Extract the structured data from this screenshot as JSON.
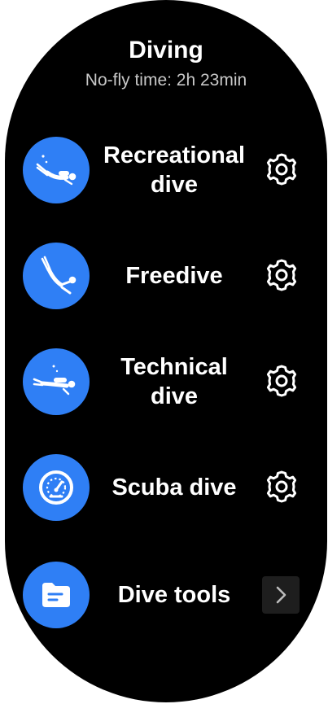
{
  "header": {
    "title": "Diving",
    "subtitle": "No-fly time: 2h 23min"
  },
  "items": [
    {
      "label_line1": "Recreational",
      "label_line2": "dive",
      "icon": "recreational-diver-icon",
      "action": "gear-icon"
    },
    {
      "label_line1": "Freedive",
      "label_line2": "",
      "icon": "freediver-icon",
      "action": "gear-icon"
    },
    {
      "label_line1": "Technical",
      "label_line2": "dive",
      "icon": "technical-diver-icon",
      "action": "gear-icon"
    },
    {
      "label_line1": "Scuba dive",
      "label_line2": "",
      "icon": "gauge-icon",
      "action": "gear-icon"
    },
    {
      "label_line1": "Dive tools",
      "label_line2": "",
      "icon": "folder-icon",
      "action": "chevron-right-icon"
    }
  ],
  "colors": {
    "accent": "#2f7ff5",
    "background": "#000000",
    "text": "#ffffff",
    "subtext": "#c8c8c8"
  }
}
